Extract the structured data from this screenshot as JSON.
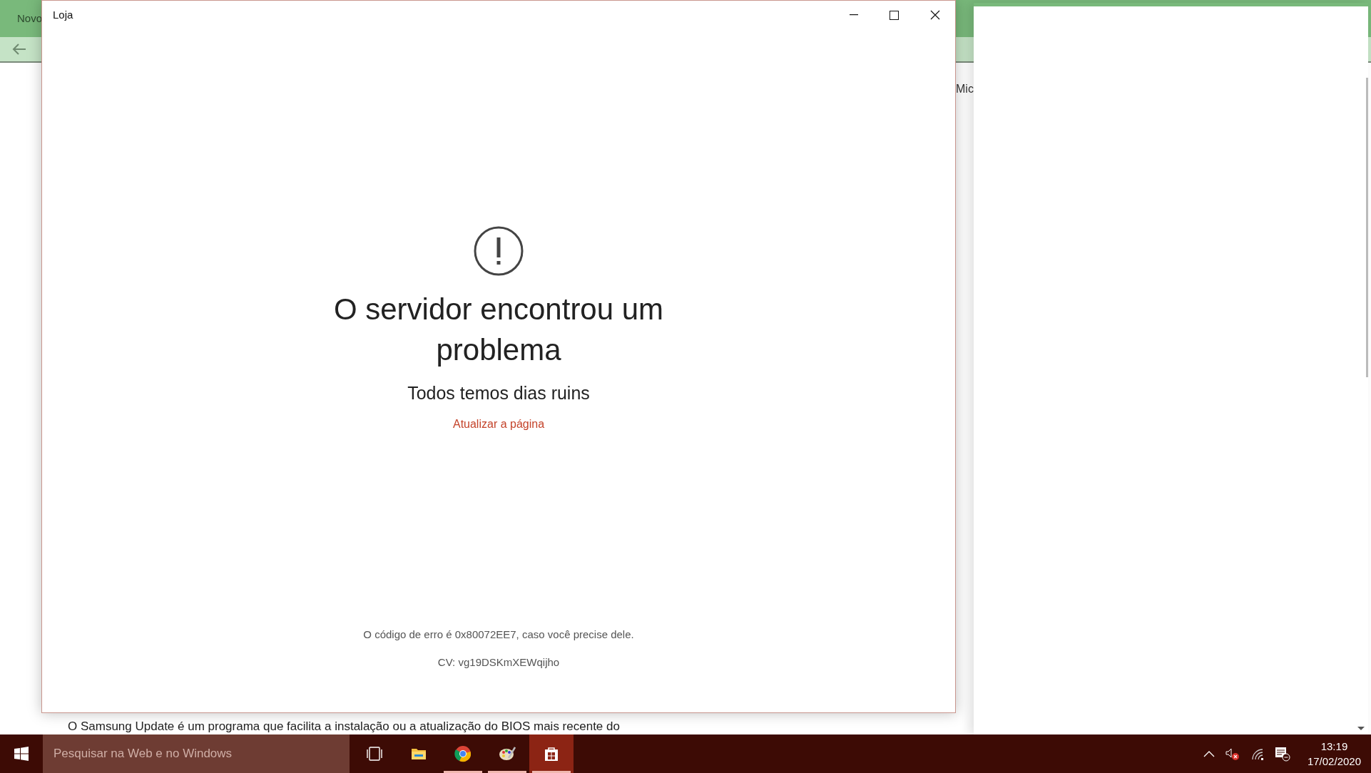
{
  "background_browser": {
    "tab_label": "Novo",
    "text_fragment": "Mic",
    "paragraph": "O Samsung Update é um programa que facilita a instalação ou a atualização do BIOS mais recente do"
  },
  "window": {
    "title": "Loja",
    "error": {
      "heading": "O servidor encontrou um problema",
      "subheading": "Todos temos dias ruins",
      "link": "Atualizar a página",
      "error_code": "O código de erro é 0x80072EE7, caso você precise dele.",
      "cv": "CV: vg19DSKmXEWqijho"
    }
  },
  "taskbar": {
    "search": {
      "placeholder": "Pesquisar na Web e no Windows"
    },
    "apps": [
      {
        "kind": "task-view",
        "open": false,
        "selected": false
      },
      {
        "kind": "files",
        "open": false,
        "selected": false
      },
      {
        "kind": "chrome",
        "open": true,
        "selected": false
      },
      {
        "kind": "paint",
        "open": true,
        "selected": false
      },
      {
        "kind": "store",
        "open": true,
        "selected": true
      }
    ],
    "clock": {
      "time": "13:19",
      "date": "17/02/2020"
    }
  }
}
